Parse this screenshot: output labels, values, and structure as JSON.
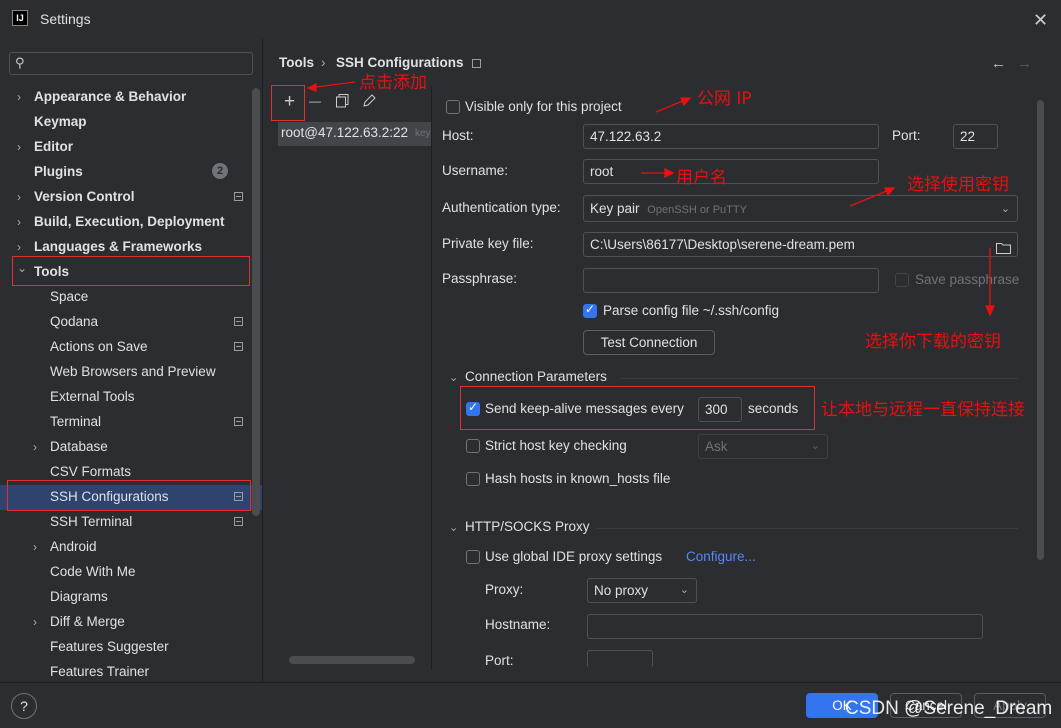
{
  "window": {
    "title": "Settings",
    "app_icon": "IJ"
  },
  "search": {
    "placeholder": "",
    "icon": "search-icon"
  },
  "sidebar": {
    "items": [
      {
        "label": "Appearance & Behavior",
        "expandable": true
      },
      {
        "label": "Keymap"
      },
      {
        "label": "Editor",
        "expandable": true
      },
      {
        "label": "Plugins",
        "badge": "2"
      },
      {
        "label": "Version Control",
        "expandable": true,
        "settings_icon": true
      },
      {
        "label": "Build, Execution, Deployment",
        "expandable": true
      },
      {
        "label": "Languages & Frameworks",
        "expandable": true
      },
      {
        "label": "Tools",
        "expanded": true
      },
      {
        "label": "Space"
      },
      {
        "label": "Qodana",
        "settings_icon": true
      },
      {
        "label": "Actions on Save",
        "settings_icon": true
      },
      {
        "label": "Web Browsers and Preview"
      },
      {
        "label": "External Tools"
      },
      {
        "label": "Terminal",
        "settings_icon": true
      },
      {
        "label": "Database",
        "expandable": true
      },
      {
        "label": "CSV Formats"
      },
      {
        "label": "SSH Configurations",
        "selected": true,
        "settings_icon": true
      },
      {
        "label": "SSH Terminal",
        "settings_icon": true
      },
      {
        "label": "Android",
        "expandable": true
      },
      {
        "label": "Code With Me"
      },
      {
        "label": "Diagrams"
      },
      {
        "label": "Diff & Merge",
        "expandable": true
      },
      {
        "label": "Features Suggester"
      },
      {
        "label": "Features Trainer"
      }
    ]
  },
  "breadcrumb": {
    "parent": "Tools",
    "separator": "›",
    "current": "SSH Configurations"
  },
  "nav": {
    "back": "←",
    "forward": "→"
  },
  "toolbar": {
    "add": "+",
    "remove": "—",
    "copy": "copy-icon",
    "edit": "edit-icon"
  },
  "ssh_list": {
    "items": [
      {
        "label": "root@47.122.63.2:22",
        "suffix": "key"
      }
    ]
  },
  "form": {
    "visible_only_label": "Visible only for this project",
    "host_label": "Host:",
    "host_value": "47.122.63.2",
    "port_label": "Port:",
    "port_value": "22",
    "username_label": "Username:",
    "username_value": "root",
    "auth_type_label": "Authentication type:",
    "auth_type_value": "Key pair",
    "auth_type_hint": "OpenSSH or PuTTY",
    "private_key_label": "Private key file:",
    "private_key_value": "C:\\Users\\86177\\Desktop\\serene-dream.pem",
    "passphrase_label": "Passphrase:",
    "passphrase_value": "",
    "save_passphrase_label": "Save passphrase",
    "parse_config_label": "Parse config file ~/.ssh/config",
    "test_connection_label": "Test Connection"
  },
  "connection_params": {
    "title": "Connection Parameters",
    "keepalive_label": "Send keep-alive messages every",
    "keepalive_value": "300",
    "keepalive_unit": "seconds",
    "strict_host_label": "Strict host key checking",
    "strict_host_value": "Ask",
    "hash_hosts_label": "Hash hosts in known_hosts file"
  },
  "proxy": {
    "title": "HTTP/SOCKS Proxy",
    "use_global_label": "Use global IDE proxy settings",
    "configure_link": "Configure...",
    "proxy_label": "Proxy:",
    "proxy_value": "No proxy",
    "hostname_label": "Hostname:",
    "hostname_value": "",
    "port_label": "Port:"
  },
  "annotations": {
    "click_add": "点击添加",
    "public_ip": "公网 IP",
    "username": "用户名",
    "choose_key": "选择使用密钥",
    "choose_downloaded_key": "选择你下载的密钥",
    "keep_alive": "让本地与远程一直保持连接"
  },
  "footer": {
    "help": "?",
    "ok": "OK",
    "cancel": "Cancel",
    "apply": "Apply"
  },
  "watermark": "CSDN @Serene_Dream",
  "colors": {
    "accent": "#3574f0",
    "annotation": "#e81010",
    "selection": "#2e436e"
  }
}
